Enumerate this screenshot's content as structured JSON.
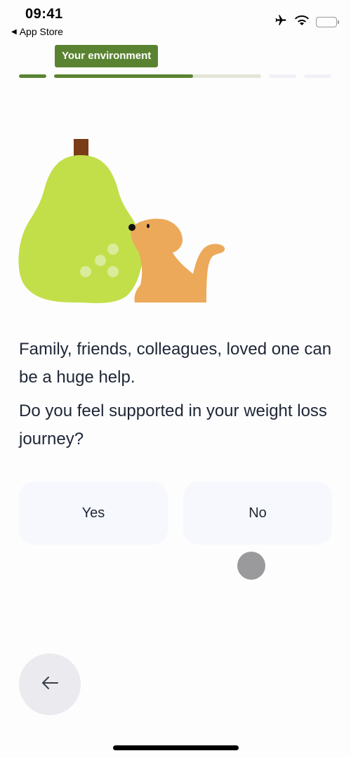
{
  "status_bar": {
    "time": "09:41",
    "back_app_label": "App Store",
    "icons": [
      "airplane-mode-icon",
      "wifi-icon",
      "battery-icon"
    ]
  },
  "header": {
    "section_tag": "Your environment",
    "progress": {
      "segments": [
        {
          "progress": 1.0
        },
        {
          "progress": 0.67
        },
        {
          "progress": 0.0
        },
        {
          "progress": 0.0
        }
      ]
    }
  },
  "illustration": {
    "description": "pear-and-dog-illustration",
    "colors": {
      "pear": "#c2df4a",
      "stem": "#7a3b17",
      "dog": "#eca95a",
      "spots": "#d9ec9a"
    }
  },
  "main": {
    "intro_text": "Family, friends, colleagues, loved one can be a huge help.",
    "question": "Do you feel supported in your weight loss journey?",
    "answers": [
      {
        "label": "Yes"
      },
      {
        "label": "No"
      }
    ]
  },
  "footer": {
    "back_button_icon": "arrow-left-icon"
  },
  "colors": {
    "accent": "#5a8331",
    "answer_bg": "#f6f8fd",
    "text": "#1e2636"
  }
}
